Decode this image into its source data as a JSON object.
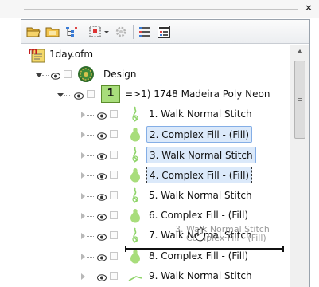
{
  "window": {
    "close_glyph": "×"
  },
  "toolbar": {
    "buttons": [
      {
        "name": "open-folder-icon"
      },
      {
        "name": "folder-icon"
      },
      {
        "name": "tree-view-icon"
      },
      {
        "name": "select-region-icon"
      },
      {
        "name": "dropdown-arrow-icon"
      },
      {
        "name": "settings-gear-icon"
      },
      {
        "name": "properties-list-icon"
      },
      {
        "name": "properties-panel-icon"
      }
    ]
  },
  "tree": {
    "file_label": "1day.ofm",
    "design_label": "Design",
    "color_group": {
      "number": "1",
      "label": "=>1) 1748 Madeira Poly Neon"
    },
    "items": [
      {
        "label": "1. Walk Normal Stitch",
        "state": "normal"
      },
      {
        "label": "2. Complex Fill - (Fill)",
        "state": "selected"
      },
      {
        "label": "3. Walk Normal Stitch",
        "state": "selected"
      },
      {
        "label": "4. Complex Fill - (Fill)",
        "state": "focused"
      },
      {
        "label": "5. Walk Normal Stitch",
        "state": "normal"
      },
      {
        "label": "6. Complex Fill - (Fill)",
        "state": "normal"
      },
      {
        "label": "7. Walk Normal Stitch",
        "state": "normal"
      },
      {
        "label": "8. Complex Fill - (Fill)",
        "state": "normal"
      },
      {
        "label": "9. Walk Normal Stitch",
        "state": "normal"
      }
    ],
    "drag_ghost": [
      "3. Walk Normal Stitch",
      "Complex Fill - (Fill)"
    ]
  },
  "colors": {
    "selection_bg": "#dbe9fa",
    "selection_border": "#84aee6",
    "thread_green": "#a8dd7b",
    "design_icon": "#2f6d2a"
  }
}
